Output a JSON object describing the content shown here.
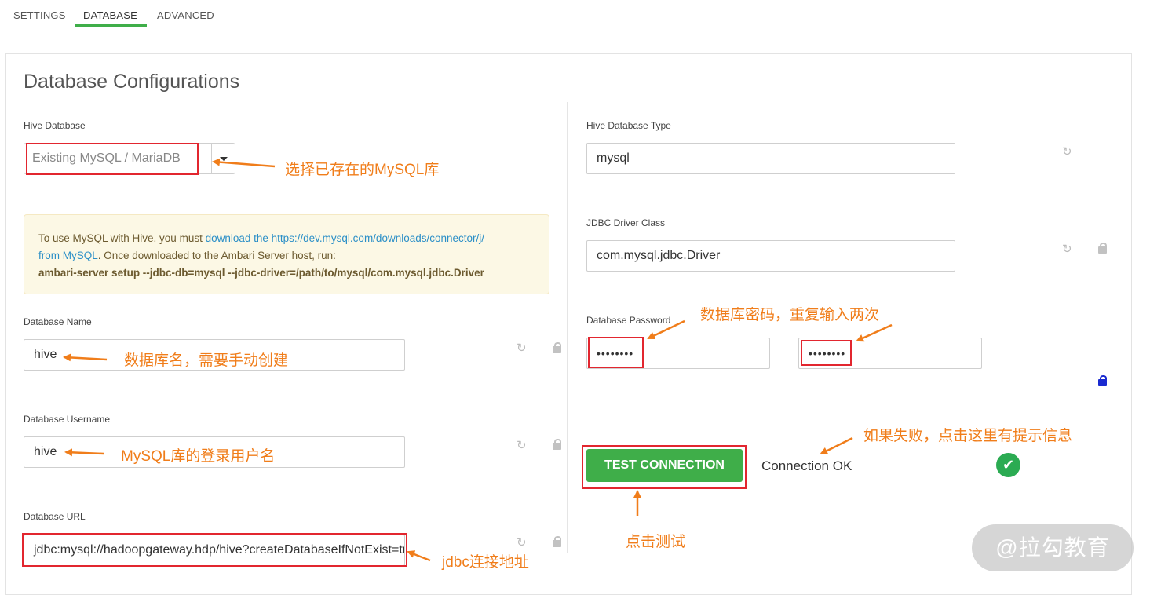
{
  "tabs": [
    {
      "label": "SETTINGS"
    },
    {
      "label": "DATABASE",
      "active": true
    },
    {
      "label": "ADVANCED"
    }
  ],
  "page_title": "Database Configurations",
  "left": {
    "hive_database": {
      "label": "Hive Database",
      "selected": "Existing MySQL / MariaDB"
    },
    "alert": {
      "text_before": "To use MySQL with Hive, you must ",
      "link1": "download the https://dev.mysql.com/downloads/connector/j/",
      "link2": "from MySQL",
      "text_after": ". Once downloaded to the Ambari Server host, run:",
      "command": "ambari-server setup --jdbc-db=mysql --jdbc-driver=/path/to/mysql/com.mysql.jdbc.Driver"
    },
    "database_name": {
      "label": "Database Name",
      "value": "hive"
    },
    "database_username": {
      "label": "Database Username",
      "value": "hive"
    },
    "database_url": {
      "label": "Database URL",
      "value": "jdbc:mysql://hadoopgateway.hdp/hive?createDatabaseIfNotExist=true"
    }
  },
  "right": {
    "hive_database_type": {
      "label": "Hive Database Type",
      "value": "mysql"
    },
    "jdbc_driver_class": {
      "label": "JDBC Driver Class",
      "value": "com.mysql.jdbc.Driver"
    },
    "database_password": {
      "label": "Database Password",
      "value": "••••••••",
      "confirm_value": "••••••••"
    },
    "test_button": "TEST CONNECTION",
    "connection_status": "Connection OK",
    "ok_icon": "check-circle-icon"
  },
  "annotations": {
    "select_existing": "选择已存在的MySQL库",
    "db_name": "数据库名，需要手动创建",
    "db_username": "MySQL库的登录用户名",
    "jdbc_url": "jdbc连接地址",
    "password": "数据库密码，重复输入两次",
    "failure_hint": "如果失败，点击这里有提示信息",
    "click_test": "点击测试"
  },
  "icons": {
    "reset": "refresh-icon",
    "lock": "lock-icon"
  },
  "watermark": "@拉勾教育",
  "colors": {
    "accent_green": "#3fae49",
    "annotation_orange": "#f07d1a",
    "highlight_red": "#e2262f",
    "link_blue": "#2b8fc7",
    "lock_blue": "#1a2ad0"
  }
}
